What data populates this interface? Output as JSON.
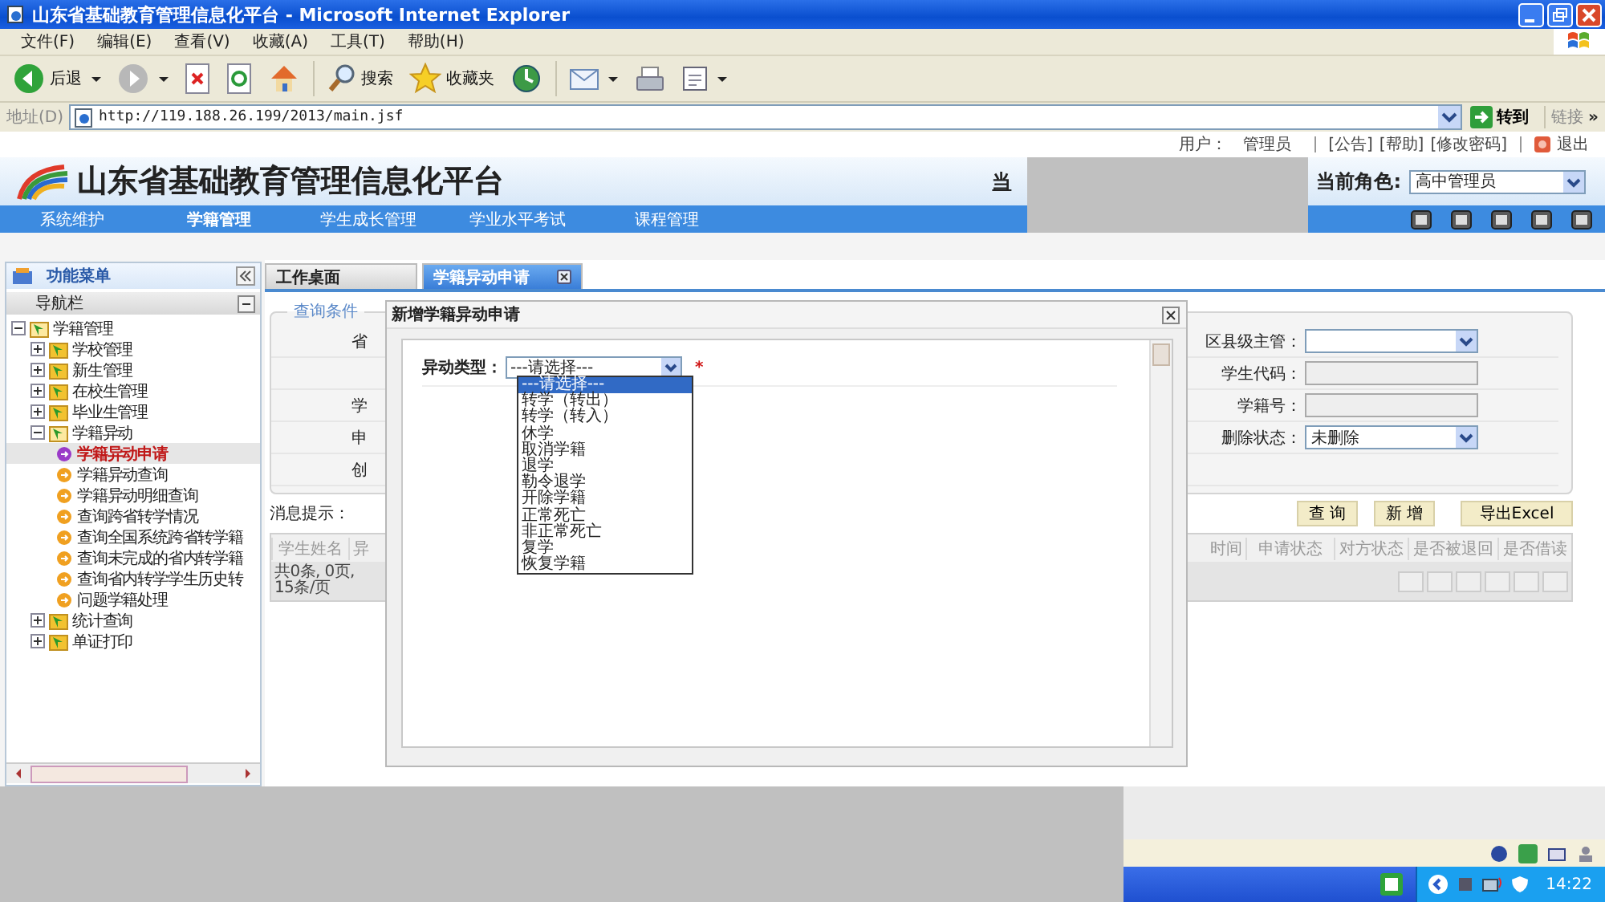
{
  "window": {
    "title": "山东省基础教育管理信息化平台 - Microsoft Internet Explorer"
  },
  "menu_bar": [
    "文件(F)",
    "编辑(E)",
    "查看(V)",
    "收藏(A)",
    "工具(T)",
    "帮助(H)"
  ],
  "toolbar": [
    {
      "kind": "back",
      "label": "后退"
    },
    {
      "kind": "forward"
    },
    {
      "kind": "stop"
    },
    {
      "kind": "refresh"
    },
    {
      "kind": "home"
    },
    {
      "kind": "search",
      "label": "搜索"
    },
    {
      "kind": "favorites",
      "label": "收藏夹"
    },
    {
      "kind": "history"
    },
    {
      "kind": "mail"
    },
    {
      "kind": "print"
    },
    {
      "kind": "edit"
    }
  ],
  "address_bar": {
    "label": "地址(D)",
    "url": "http://119.188.26.199/2013/main.jsf",
    "go": "转到",
    "links": "链接",
    "more": "»"
  },
  "header": {
    "logo_text": "山东省基础教育管理信息化平台",
    "user_label": "用户：",
    "user": "管理员",
    "links": [
      "[公告]",
      "[帮助]",
      "[修改密码]"
    ],
    "logout": "退出",
    "cut_label": "当",
    "role_label": "当前角色:",
    "role": "高中管理员"
  },
  "nav": [
    {
      "label": "系统维护",
      "selected": false
    },
    {
      "label": "学籍管理",
      "selected": true
    },
    {
      "label": "学生成长管理",
      "selected": false
    },
    {
      "label": "学业水平考试",
      "selected": false
    },
    {
      "label": "课程管理",
      "selected": false
    }
  ],
  "sidebar": {
    "title": "功能菜单",
    "nav_title": "导航栏",
    "tree": [
      {
        "label": "学籍管理",
        "expanded": true,
        "children": [
          {
            "label": "学校管理",
            "expanded": false
          },
          {
            "label": "新生管理",
            "expanded": false
          },
          {
            "label": "在校生管理",
            "expanded": false
          },
          {
            "label": "毕业生管理",
            "expanded": false
          },
          {
            "label": "学籍异动",
            "expanded": true,
            "children": [
              {
                "label": "学籍异动申请",
                "selected": true
              },
              {
                "label": "学籍异动查询",
                "selected": false
              },
              {
                "label": "学籍异动明细查询",
                "selected": false
              },
              {
                "label": "查询跨省转学情况",
                "selected": false
              },
              {
                "label": "查询全国系统跨省转学籍",
                "selected": false
              },
              {
                "label": "查询未完成的省内转学籍",
                "selected": false
              },
              {
                "label": "查询省内转学学生历史转",
                "selected": false
              },
              {
                "label": "问题学籍处理",
                "selected": false
              }
            ]
          },
          {
            "label": "统计查询",
            "expanded": false
          },
          {
            "label": "单证打印",
            "expanded": false
          }
        ]
      }
    ]
  },
  "tabs": [
    {
      "label": "工作桌面",
      "selected": false
    },
    {
      "label": "学籍异动申请",
      "selected": true
    }
  ],
  "query": {
    "legend": "查询条件",
    "rows": [
      {
        "left_label": "省",
        "label": "区县级主管：",
        "kind": "select"
      },
      {
        "label": "学生代码：",
        "kind": "input"
      },
      {
        "left_label": "学",
        "label": "学籍号：",
        "kind": "input"
      },
      {
        "left_label": "申",
        "label": "删除状态：",
        "kind": "select",
        "value": "未删除"
      },
      {
        "left_label": "创"
      }
    ]
  },
  "message_label": "消息提示：",
  "buttons": [
    "查 询",
    "新 增",
    "导出Excel"
  ],
  "table": {
    "columns": [
      "学生姓名",
      "异",
      "时间",
      "申请状态",
      "对方状态",
      "是否被退回",
      "是否借读"
    ],
    "footer": "共0条, 0页, 15条/页"
  },
  "dialog": {
    "title": "新增学籍异动申请",
    "field_label": "异动类型：",
    "value": "---请选择---",
    "required": "*",
    "options": [
      {
        "label": "---请选择---",
        "selected": true
      },
      {
        "label": "转学（转出）",
        "selected": false
      },
      {
        "label": "转学（转入）",
        "selected": false
      },
      {
        "label": "休学",
        "selected": false
      },
      {
        "label": "取消学籍",
        "selected": false
      },
      {
        "label": "退学",
        "selected": false
      },
      {
        "label": "勒令退学",
        "selected": false
      },
      {
        "label": "开除学籍",
        "selected": false
      },
      {
        "label": "正常死亡",
        "selected": false
      },
      {
        "label": "非正常死亡",
        "selected": false
      },
      {
        "label": "复学",
        "selected": false
      },
      {
        "label": "恢复学籍",
        "selected": false
      }
    ]
  },
  "taskbar": {
    "clock": "14:22"
  }
}
